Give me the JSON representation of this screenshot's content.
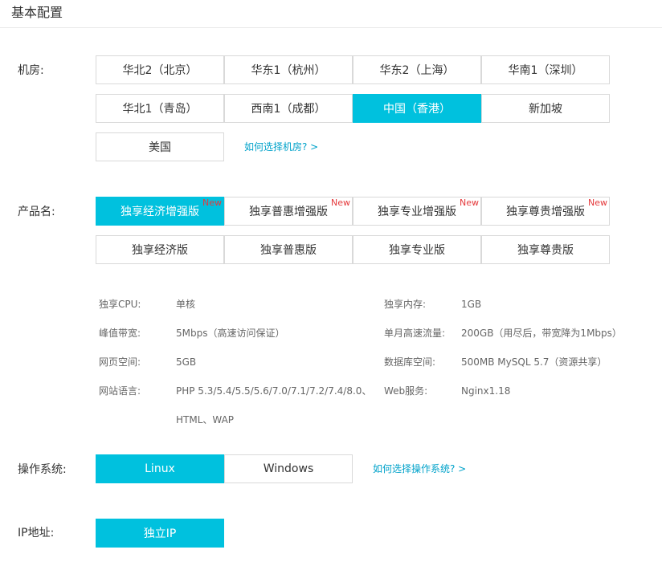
{
  "header": {
    "title": "基本配置"
  },
  "datacenter": {
    "label": "机房:",
    "options": [
      {
        "label": "华北2（北京）",
        "active": false
      },
      {
        "label": "华东1（杭州）",
        "active": false
      },
      {
        "label": "华东2（上海）",
        "active": false
      },
      {
        "label": "华南1（深圳）",
        "active": false
      },
      {
        "label": "华北1（青岛）",
        "active": false
      },
      {
        "label": "西南1（成都）",
        "active": false
      },
      {
        "label": "中国（香港）",
        "active": true
      },
      {
        "label": "新加坡",
        "active": false
      },
      {
        "label": "美国",
        "active": false
      }
    ],
    "help_link": "如何选择机房? >"
  },
  "product": {
    "label": "产品名:",
    "options": [
      {
        "label": "独享经济增强版",
        "badge": "New",
        "active": true
      },
      {
        "label": "独享普惠增强版",
        "badge": "New",
        "active": false
      },
      {
        "label": "独享专业增强版",
        "badge": "New",
        "active": false
      },
      {
        "label": "独享尊贵增强版",
        "badge": "New",
        "active": false
      },
      {
        "label": "独享经济版",
        "active": false
      },
      {
        "label": "独享普惠版",
        "active": false
      },
      {
        "label": "独享专业版",
        "active": false
      },
      {
        "label": "独享尊贵版",
        "active": false
      }
    ]
  },
  "specs": {
    "cpu": {
      "label": "独享CPU:",
      "value": "单核"
    },
    "memory": {
      "label": "独享内存:",
      "value": "1GB"
    },
    "bandwidth": {
      "label": "峰值带宽:",
      "value": "5Mbps（高速访问保证）"
    },
    "traffic": {
      "label": "单月高速流量:",
      "value": "200GB（用尽后，带宽降为1Mbps）"
    },
    "web_space": {
      "label": "网页空间:",
      "value": "5GB"
    },
    "db_space": {
      "label": "数据库空间:",
      "value": "500MB MySQL 5.7（资源共享）"
    },
    "language": {
      "label": "网站语言:",
      "value_line1": "PHP 5.3/5.4/5.5/5.6/7.0/7.1/7.2/7.4/8.0、",
      "value_line2": "HTML、WAP"
    },
    "web_service": {
      "label": "Web服务:",
      "value": "Nginx1.18"
    }
  },
  "os": {
    "label": "操作系统:",
    "options": [
      {
        "label": "Linux",
        "active": true
      },
      {
        "label": "Windows",
        "active": false
      }
    ],
    "help_link": "如何选择操作系统? >"
  },
  "ip": {
    "label": "IP地址:",
    "options": [
      {
        "label": "独立IP",
        "active": true
      }
    ]
  },
  "colors": {
    "accent": "#00c1de",
    "badge": "#e4393c",
    "link": "#00a2ca"
  }
}
